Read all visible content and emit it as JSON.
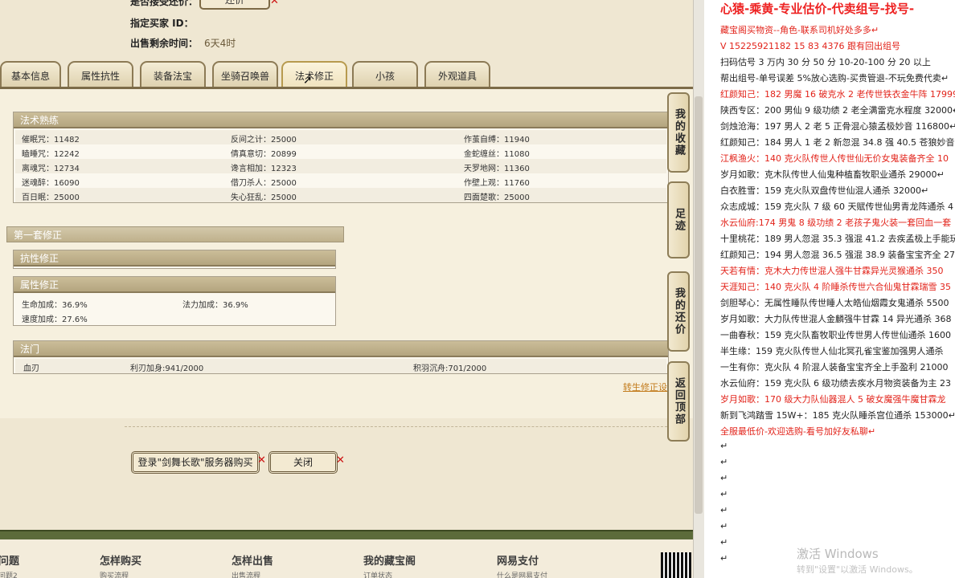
{
  "header": {
    "bargain_label": "是否接受还价：",
    "bargain_button": "还价",
    "buyer_id_label": "指定买家 ID：",
    "time_left_label": "出售剩余时间：",
    "time_left_value": "6天4时"
  },
  "tabs": [
    {
      "label": "基本信息"
    },
    {
      "label": "属性抗性"
    },
    {
      "label": "装备法宝"
    },
    {
      "label": "坐骑召唤兽"
    },
    {
      "label": "法术修正"
    },
    {
      "label": "小孩"
    },
    {
      "label": "外观道具"
    }
  ],
  "spell_skill": {
    "title": "法术熟练",
    "rows": [
      [
        "催眠咒：11482",
        "反间之计：25000",
        "作茧自缚：11940"
      ],
      [
        "瞌睡咒：12242",
        "倩真意切：20899",
        "金蛇缠丝：11080"
      ],
      [
        "离魂咒：12734",
        "谗言相加：12323",
        "天罗地网：11360"
      ],
      [
        "迷魂醉：16090",
        "借刀杀人：25000",
        "作壁上观：11760"
      ],
      [
        "百日眠：25000",
        "失心狂乱：25000",
        "四面楚歌：25000"
      ]
    ]
  },
  "first_set": {
    "title": "第一套修正",
    "resist_title": "抗性修正",
    "attr_title": "属性修正",
    "attr_rows": [
      [
        "生命加成：36.9%",
        "法力加成：36.9%"
      ],
      [
        "速度加成：27.6%",
        ""
      ]
    ]
  },
  "magic": {
    "title": "法门",
    "items": [
      "血刃",
      "利刃加身:941/2000",
      "积羽沉舟:701/2000"
    ]
  },
  "reincarnate_link": "转生修正设",
  "buttons": {
    "login_buy": "登录\"剑舞长歌\"服务器购买",
    "close": "关闭"
  },
  "sidebar": [
    {
      "label": "我的收藏"
    },
    {
      "label": "足迹"
    },
    {
      "label": "我的还价"
    },
    {
      "label": "返回顶部"
    }
  ],
  "footer": [
    {
      "title": "问题",
      "sub": "问题2"
    },
    {
      "title": "怎样购买",
      "sub": "购买流程"
    },
    {
      "title": "怎样出售",
      "sub": "出售流程"
    },
    {
      "title": "我的藏宝阁",
      "sub": "订单状态"
    },
    {
      "title": "网易支付",
      "sub": "什么是网易支付"
    }
  ],
  "right_doc": {
    "title": "心猿-乘黄-专业估价-代卖组号-找号-",
    "lines": [
      {
        "text": "藏宝阁买物资--角色-联系司机好处多多↵",
        "color": "red"
      },
      {
        "text": "V 15225921182   15  83  4376  跟有回出组号",
        "color": "red"
      },
      {
        "text": "扫码估号 3 万内 30 分  50 分  10-20-100 分  20 以上",
        "color": "dark"
      },
      {
        "text": "帮出组号-单号误差 5%放心选购-买贵管退-不玩免费代卖↵",
        "color": "dark"
      },
      {
        "text": "红颜知己：182 男魔 16 破克水 2 老传世铁衣金牛阵 17999↵",
        "color": "red"
      },
      {
        "text": "陕西专区：200 男仙 9 级功绩 2 老全满雷克水程度 32000↵",
        "color": "dark"
      },
      {
        "text": "剑烛沧海：197 男人 2 老 5 正骨混心猿孟极妙音 116800↵",
        "color": "dark"
      },
      {
        "text": "红颜知己：184 男人 1 老 2 新忽混 34.8 强 40.5 苍狼妙音 22",
        "color": "dark"
      },
      {
        "text": "江枫渔火：140 克火队传世人传世仙无价女鬼装备齐全 10",
        "color": "red"
      },
      {
        "text": "岁月如歌：克木队传世人仙鬼种植畜牧职业通杀 29000↵",
        "color": "dark"
      },
      {
        "text": "白衣胜雪：159 克火队双盘传世仙混人通杀 32000↵",
        "color": "dark"
      },
      {
        "text": "众志成城：159 克火队 7 级 60 天赋传世仙男青龙阵通杀 4",
        "color": "dark"
      },
      {
        "text": "水云仙府:174 男鬼 8 级功绩 2 老孩子鬼火装一套回血一套",
        "color": "red"
      },
      {
        "text": "十里桃花：189 男人忽混 35.3 强混 41.2 去疾孟极上手能玩",
        "color": "dark"
      },
      {
        "text": "红颜知己：194 男人忽混 36.5 强混 38.9 装备宝宝齐全 275",
        "color": "dark"
      },
      {
        "text": "天若有情：克木大力传世混人强牛甘霖异光灵猴通杀 350",
        "color": "red"
      },
      {
        "text": "天涯知己：140 克火队 4 阶睡杀传世六合仙鬼甘霖瑞雪 35",
        "color": "red"
      },
      {
        "text": "剑胆琴心：无属性睡队传世睡人太皓仙烟霞女鬼通杀 5500",
        "color": "dark"
      },
      {
        "text": "岁月如歌：大力队传世混人金麟强牛甘霖 14 异光通杀 368",
        "color": "dark"
      },
      {
        "text": "一曲春秋：159 克火队畜牧职业传世男人传世仙通杀 1600",
        "color": "dark"
      },
      {
        "text": "半生缘：159 克火队传世人仙北冥孔雀宝鉴加强男人通杀",
        "color": "dark"
      },
      {
        "text": "一生有你：克火队 4 阶混人装备宝宝齐全上手盈利 21000",
        "color": "dark"
      },
      {
        "text": "水云仙府：159 克火队 6 级功绩去疾水月物资装备为主 23",
        "color": "dark"
      },
      {
        "text": "岁月如歌：170 级大力队仙器混人 5 破女魔强牛魔甘霖龙",
        "color": "red"
      },
      {
        "text": "新到飞鸿踏雪 15W+：185 克火队睡杀宫位通杀 153000↵",
        "color": "dark"
      },
      {
        "text": "全服最低价-欢迎选购-看号加好友私聊↵",
        "color": "red"
      },
      {
        "text": "↵",
        "color": "dark"
      },
      {
        "text": "↵",
        "color": "dark"
      },
      {
        "text": "↵",
        "color": "dark"
      },
      {
        "text": "↵",
        "color": "dark"
      },
      {
        "text": "↵",
        "color": "dark"
      },
      {
        "text": "↵",
        "color": "dark"
      },
      {
        "text": "↵",
        "color": "dark"
      },
      {
        "text": "↵",
        "color": "dark"
      }
    ]
  },
  "watermark": {
    "line1": "激活 Windows",
    "line2": "转到\"设置\"以激活 Windows。"
  }
}
